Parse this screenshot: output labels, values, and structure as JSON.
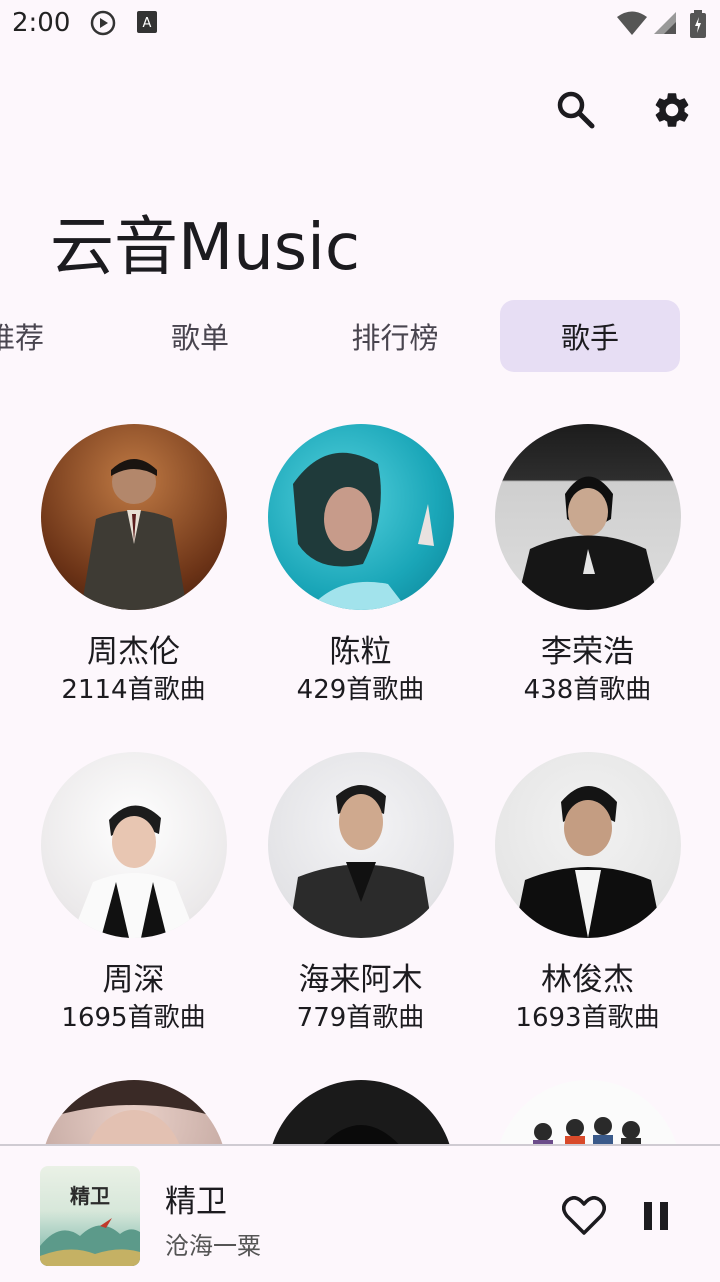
{
  "status_bar": {
    "time": "2:00",
    "icons": [
      "play-circle-icon",
      "a-notification-icon",
      "wifi-icon",
      "signal-icon",
      "battery-icon"
    ]
  },
  "header": {
    "title": "云音Music",
    "actions": [
      "search-icon",
      "settings-gear-icon"
    ]
  },
  "tabs": [
    {
      "label": "推荐",
      "active": false
    },
    {
      "label": "歌单",
      "active": false
    },
    {
      "label": "排行榜",
      "active": false
    },
    {
      "label": "歌手",
      "active": true
    }
  ],
  "artists": [
    {
      "name": "周杰伦",
      "count": "2114首歌曲"
    },
    {
      "name": "陈粒",
      "count": "429首歌曲"
    },
    {
      "name": "李荣浩",
      "count": "438首歌曲"
    },
    {
      "name": "周深",
      "count": "1695首歌曲"
    },
    {
      "name": "海来阿木",
      "count": "779首歌曲"
    },
    {
      "name": "林俊杰",
      "count": "1693首歌曲"
    },
    {
      "name": "",
      "count": ""
    },
    {
      "name": "",
      "count": ""
    },
    {
      "name": "",
      "count": ""
    }
  ],
  "now_playing": {
    "title": "精卫",
    "artist": "沧海一粟",
    "cover_text": "精卫",
    "liked": false,
    "playing": true
  },
  "colors": {
    "background": "#fdf7fc",
    "active_tab": "#e7def4",
    "text": "#1c1b1f"
  }
}
